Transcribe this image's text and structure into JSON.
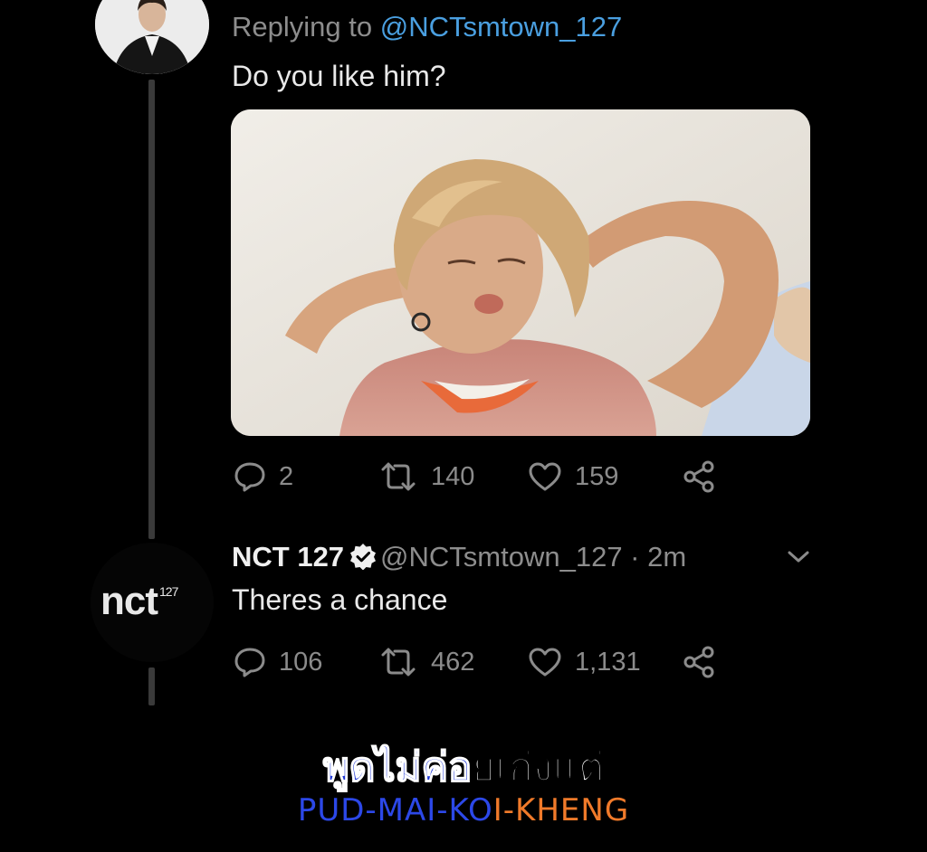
{
  "tweet1": {
    "replying_prefix": "Replying to ",
    "replying_handle": "@NCTsmtown_127",
    "text": "Do you like him?",
    "actions": {
      "replies": "2",
      "retweets": "140",
      "likes": "159"
    }
  },
  "tweet2": {
    "name": "NCT 127",
    "handle_time": "@NCTsmtown_127 · 2m",
    "text": "Theres a chance",
    "logo_main": "nct",
    "logo_sup": "127",
    "actions": {
      "replies": "106",
      "retweets": "462",
      "likes": "1,131"
    }
  },
  "subtitle": {
    "thai_blue": "พูดไม่ค่อ",
    "thai_white": "ยเก่งแต่",
    "rom_blue": "PUD-MAI-KO",
    "rom_orange": "I-KHENG"
  },
  "colors": {
    "background": "#000000",
    "link_blue": "#4a9fe0",
    "muted": "#8d8d8d",
    "subtitle_blue": "#1d36d6",
    "subtitle_orange": "#f07a2a"
  },
  "icons": [
    "reply-icon",
    "retweet-icon",
    "like-icon",
    "share-icon",
    "verified-icon",
    "chevron-down-icon"
  ]
}
